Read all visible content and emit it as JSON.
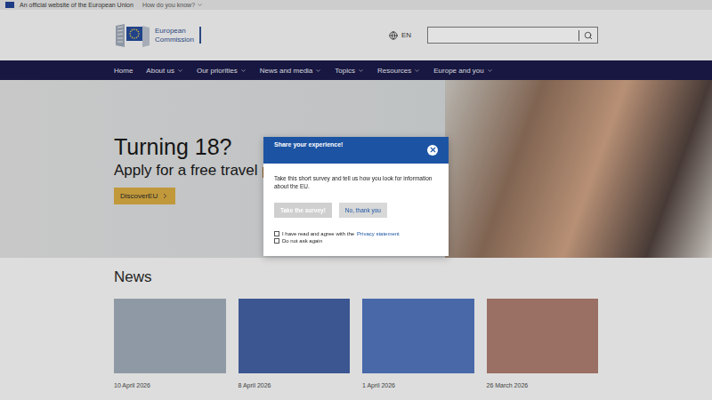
{
  "top_bar": {
    "text": "An official website of the European Union",
    "link": "How do you know?"
  },
  "header": {
    "logo": [
      "European",
      "Commission"
    ],
    "language": "EN"
  },
  "nav": [
    {
      "label": "Home",
      "dropdown": false
    },
    {
      "label": "About us",
      "dropdown": true
    },
    {
      "label": "Our priorities",
      "dropdown": true
    },
    {
      "label": "News and media",
      "dropdown": true
    },
    {
      "label": "Topics",
      "dropdown": true
    },
    {
      "label": "Resources",
      "dropdown": true
    },
    {
      "label": "Europe and you",
      "dropdown": true
    }
  ],
  "hero": {
    "title": "Turning 18?",
    "subtitle": "Apply for a free travel pa",
    "button": "DiscoverEU"
  },
  "news": {
    "title": "News",
    "cards": [
      {
        "date": "10 April 2026",
        "color": "#9aa7b4"
      },
      {
        "date": "8 April 2026",
        "color": "#3d5a9e"
      },
      {
        "date": "1 April 2026",
        "color": "#4a6fb8"
      },
      {
        "date": "26 March 2026",
        "color": "#a8776a"
      }
    ]
  },
  "dialog": {
    "title": "Share your experience!",
    "text": "Take this short survey and tell us how you look for information about the EU.",
    "buttons": [
      {
        "label": "Take the survey!",
        "disabled": true
      },
      {
        "label": "No, thank you",
        "disabled": false
      }
    ],
    "checkboxes": [
      {
        "label": "I have read and agree with the",
        "link": "Privacy statement",
        "checked": false
      },
      {
        "label": "Do not ask again",
        "link": "",
        "checked": false
      }
    ]
  }
}
